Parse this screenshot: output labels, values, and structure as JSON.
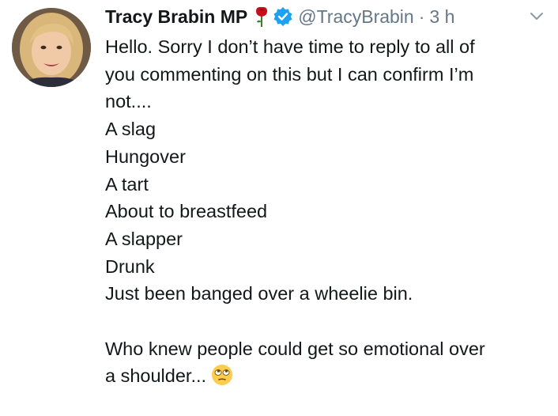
{
  "author": {
    "name": "Tracy Brabin MP",
    "handle": "@TracyBrabin",
    "separator": "·",
    "timestamp": "3 h",
    "rose_icon": "rose-icon",
    "verified_icon": "verified-badge-icon"
  },
  "tweet": {
    "lines": [
      "Hello. Sorry I don’t have time to reply to all of",
      "you commenting on this but I can confirm I’m",
      "not....",
      "A slag",
      "Hungover",
      "A tart",
      "About to breastfeed",
      "A slapper",
      "Drunk",
      "Just been banged over a wheelie bin."
    ],
    "closing_line_1": "Who knew people could get so emotional over",
    "closing_line_2": "a shoulder...",
    "emoji": "eye-roll-emoji"
  },
  "colors": {
    "text": "#14171a",
    "secondary_text": "#657786",
    "verified_blue": "#1da1f2",
    "rose_red": "#c4101c"
  }
}
